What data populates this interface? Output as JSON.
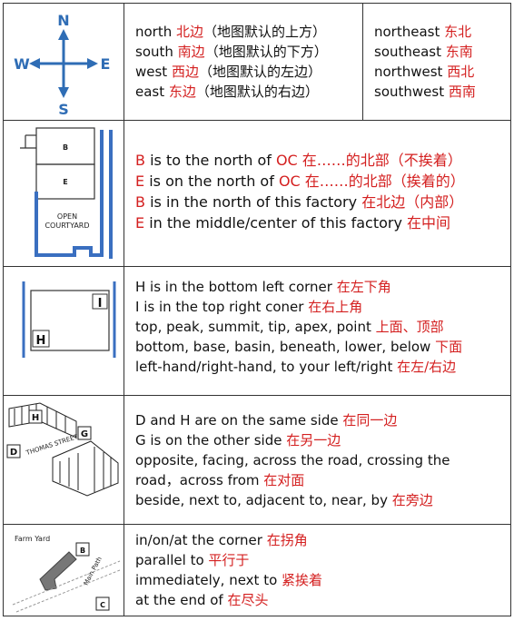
{
  "row1": {
    "compass": {
      "n": "N",
      "s": "S",
      "w": "W",
      "e": "E"
    },
    "left": [
      {
        "en": "north",
        "zh": "北边",
        "note": "（地图默认的上方）"
      },
      {
        "en": "south",
        "zh": "南边",
        "note": "（地图默认的下方）"
      },
      {
        "en": "west",
        "zh": "西边",
        "note": "（地图默认的左边）"
      },
      {
        "en": "east",
        "zh": "东边",
        "note": "（地图默认的右边）"
      }
    ],
    "right": [
      {
        "en": "northeast",
        "zh": "东北"
      },
      {
        "en": "southeast",
        "zh": "东南"
      },
      {
        "en": "northwest",
        "zh": "西北"
      },
      {
        "en": "southwest",
        "zh": "西南"
      }
    ]
  },
  "row2": {
    "map": {
      "b": "B",
      "e": "E",
      "yard1": "OPEN",
      "yard2": "COURTYARD"
    },
    "lines": [
      {
        "a": "B",
        "b": " is to the north of ",
        "c": "OC",
        "d": "  在……的北部（不挨着）"
      },
      {
        "a": "E",
        "b": " is on the north of ",
        "c": "OC",
        "d": "  在……的北部（挨着的）"
      },
      {
        "a": "B",
        "b": " is in the north  of this factory ",
        "c": "",
        "d": "在北边（内部）"
      },
      {
        "a": "E",
        "b": " in the middle/center of this factory ",
        "c": "",
        "d": " 在中间"
      }
    ]
  },
  "row3": {
    "map": {
      "i": "I",
      "h": "H"
    },
    "lines": [
      {
        "en": "H is in the bottom left corner  ",
        "zh": "在左下角"
      },
      {
        "en": "I is in the top right coner  ",
        "zh": "在右上角"
      },
      {
        "en": "top, peak, summit, tip, apex, point ",
        "zh": "上面、顶部"
      },
      {
        "en": "bottom, base, basin, beneath, lower, below  ",
        "zh": "下面"
      },
      {
        "en": "left-hand/right-hand, to your left/right  ",
        "zh": "在左/右边"
      }
    ]
  },
  "row4": {
    "map": {
      "h": "H",
      "g": "G",
      "d": "D",
      "street": "THOMAS STREET"
    },
    "lines": [
      {
        "en": "D and H are on the same side  ",
        "zh": "在同一边"
      },
      {
        "en": "G is on the other side ",
        "zh": "在另一边"
      },
      {
        "en": "opposite, facing, across the road, crossing the",
        "zh": ""
      },
      {
        "en": "road，across from ",
        "zh": "在对面"
      },
      {
        "en": "beside, next to, adjacent to, near, by  ",
        "zh": "在旁边"
      }
    ]
  },
  "row5": {
    "map": {
      "farm": "Farm Yard",
      "b": "B",
      "path": "Main Path",
      "c": "C"
    },
    "lines": [
      {
        "en": "in/on/at the corner ",
        "zh": "在拐角"
      },
      {
        "en": "parallel to  ",
        "zh": "平行于"
      },
      {
        "en": "immediately, next to  ",
        "zh": "紧挨着"
      },
      {
        "en": "at the end of  ",
        "zh": "在尽头"
      }
    ]
  }
}
